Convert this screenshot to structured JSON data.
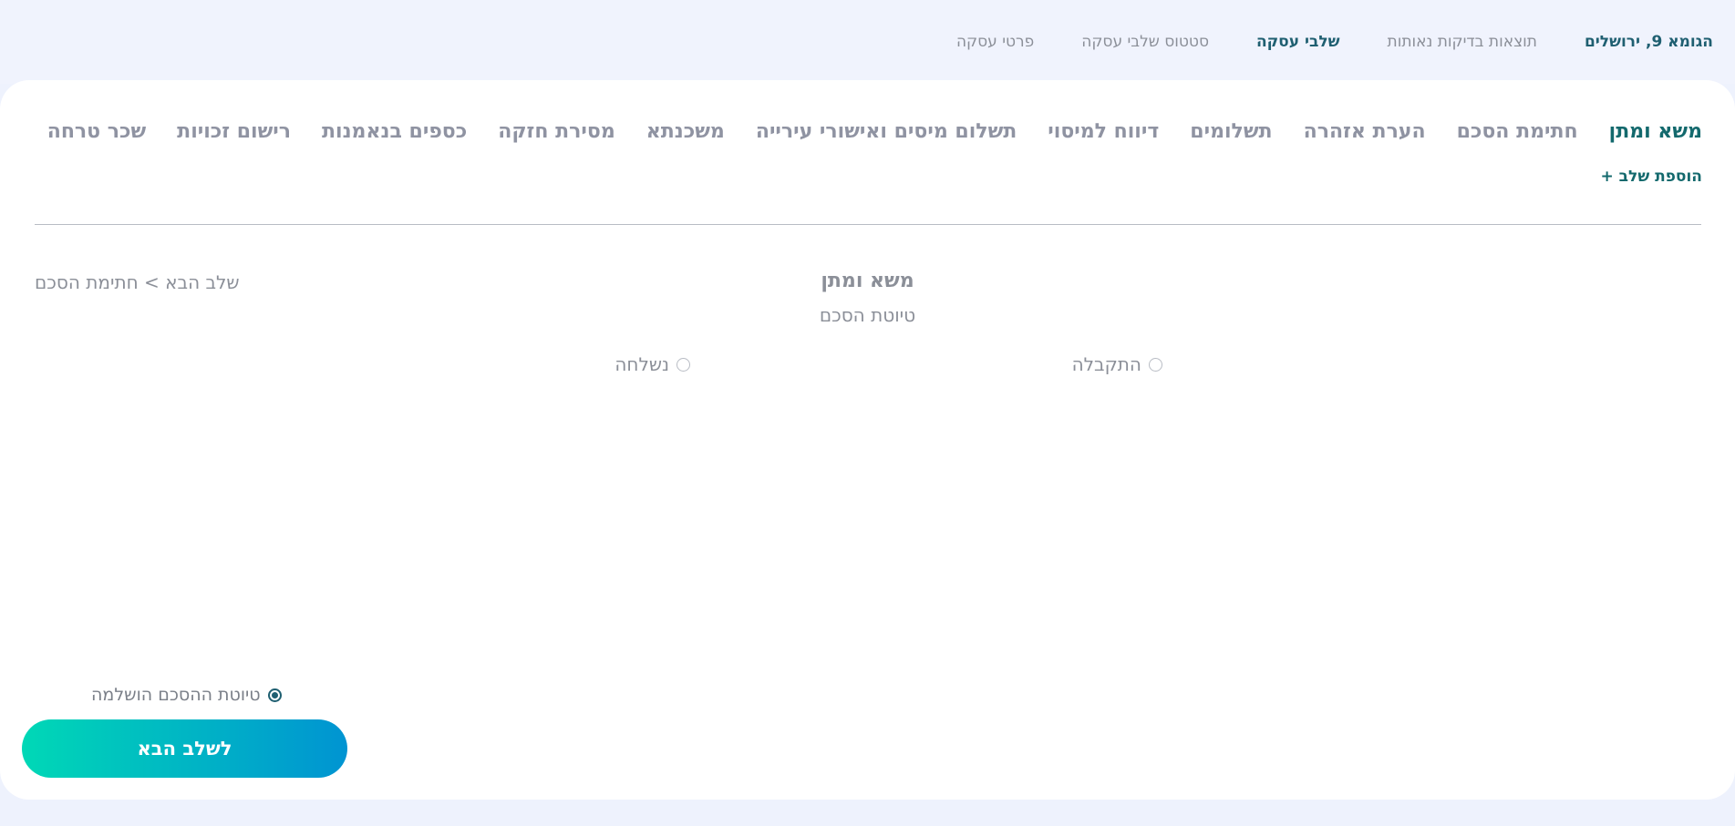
{
  "topnav": {
    "address": "הגומא 9, ירושלים",
    "items": [
      "תוצאות בדיקות נאותות",
      "שלבי עסקה",
      "סטטוס שלבי עסקה",
      "פרטי עסקה"
    ],
    "active_index": 1
  },
  "steps": {
    "items": [
      "משא ומתן",
      "חתימת הסכם",
      "הערת אזהרה",
      "תשלומים",
      "דיווח למיסוי",
      "תשלום מיסים ואישורי עירייה",
      "משכנתא",
      "מסירת חזקה",
      "כספים בנאמנות",
      "רישום זכויות",
      "שכר טרחה"
    ],
    "current_index": 0,
    "add_label": "הוספת שלב +"
  },
  "stage": {
    "next_link": "שלב הבא > חתימת הסכם",
    "title": "משא ומתן",
    "subtitle": "טיוטת הסכם",
    "options": {
      "received": "התקבלה",
      "sent": "נשלחה"
    },
    "completed_label": "טיוטת ההסכם הושלמה",
    "completed_checked": true,
    "next_button": "לשלב הבא"
  },
  "colors": {
    "accent": "#13696d",
    "gradient_start": "#00d8b6",
    "gradient_end": "#0094d2",
    "background": "#eef2fd"
  }
}
